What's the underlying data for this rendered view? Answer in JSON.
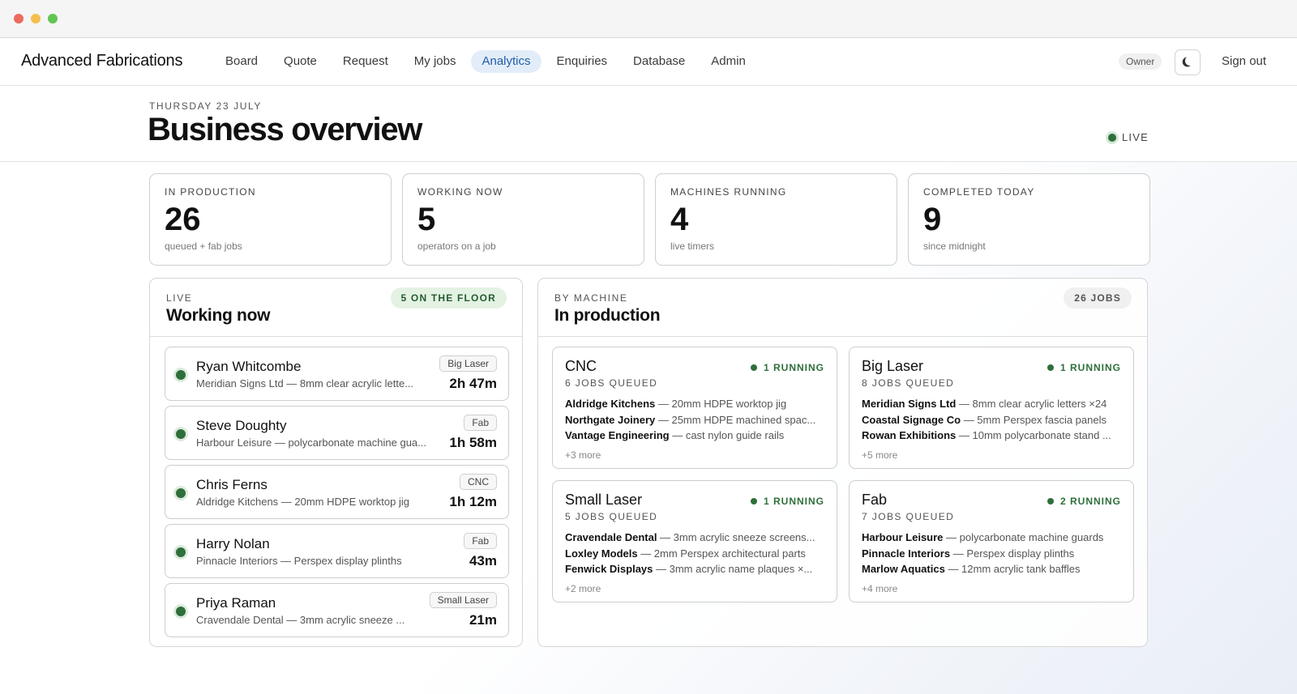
{
  "app": {
    "brand": "Advanced Fabrications",
    "nav": [
      {
        "label": "Board"
      },
      {
        "label": "Quote"
      },
      {
        "label": "Request"
      },
      {
        "label": "My jobs"
      },
      {
        "label": "Analytics",
        "active": true
      },
      {
        "label": "Enquiries"
      },
      {
        "label": "Database"
      },
      {
        "label": "Admin"
      }
    ],
    "role_badge": "Owner",
    "theme_icon": "moon-icon",
    "signout_label": "Sign out"
  },
  "header": {
    "date": "THURSDAY 23 JULY",
    "title": "Business overview",
    "live_label": "LIVE"
  },
  "stats": [
    {
      "label": "IN PRODUCTION",
      "value": "26",
      "sub": "queued + fab jobs"
    },
    {
      "label": "WORKING NOW",
      "value": "5",
      "sub": "operators on a job"
    },
    {
      "label": "MACHINES RUNNING",
      "value": "4",
      "sub": "live timers"
    },
    {
      "label": "COMPLETED TODAY",
      "value": "9",
      "sub": "since midnight"
    }
  ],
  "working": {
    "kicker": "LIVE",
    "title": "Working now",
    "pill": "5 ON THE FLOOR",
    "workers": [
      {
        "name": "Ryan Whitcombe",
        "job": "Meridian Signs Ltd — 8mm clear acrylic lette...",
        "tag": "Big Laser",
        "time": "2h 47m"
      },
      {
        "name": "Steve Doughty",
        "job": "Harbour Leisure — polycarbonate machine gua...",
        "tag": "Fab",
        "time": "1h 58m"
      },
      {
        "name": "Chris Ferns",
        "job": "Aldridge Kitchens — 20mm HDPE worktop jig",
        "tag": "CNC",
        "time": "1h 12m"
      },
      {
        "name": "Harry Nolan",
        "job": "Pinnacle Interiors — Perspex display plinths",
        "tag": "Fab",
        "time": "43m"
      },
      {
        "name": "Priya Raman",
        "job": "Cravendale Dental — 3mm acrylic sneeze ...",
        "tag": "Small Laser",
        "time": "21m"
      }
    ]
  },
  "production": {
    "kicker": "BY MACHINE",
    "title": "In production",
    "pill": "26 JOBS",
    "machines": [
      {
        "name": "CNC",
        "queued": "6 JOBS QUEUED",
        "running": "1 RUNNING",
        "jobs": [
          {
            "client": "Aldridge Kitchens",
            "desc": " — 20mm HDPE worktop jig"
          },
          {
            "client": "Northgate Joinery",
            "desc": " — 25mm HDPE machined spac..."
          },
          {
            "client": "Vantage Engineering",
            "desc": " — cast nylon guide rails"
          }
        ],
        "more": "+3 more"
      },
      {
        "name": "Big Laser",
        "queued": "8 JOBS QUEUED",
        "running": "1 RUNNING",
        "jobs": [
          {
            "client": "Meridian Signs Ltd",
            "desc": " — 8mm clear acrylic letters ×24"
          },
          {
            "client": "Coastal Signage Co",
            "desc": " — 5mm Perspex fascia panels"
          },
          {
            "client": "Rowan Exhibitions",
            "desc": " — 10mm polycarbonate stand ..."
          }
        ],
        "more": "+5 more"
      },
      {
        "name": "Small Laser",
        "queued": "5 JOBS QUEUED",
        "running": "1 RUNNING",
        "jobs": [
          {
            "client": "Cravendale Dental",
            "desc": " — 3mm acrylic sneeze screens..."
          },
          {
            "client": "Loxley Models",
            "desc": " — 2mm Perspex architectural parts"
          },
          {
            "client": "Fenwick Displays",
            "desc": " — 3mm acrylic name plaques ×..."
          }
        ],
        "more": "+2 more"
      },
      {
        "name": "Fab",
        "queued": "7 JOBS QUEUED",
        "running": "2 RUNNING",
        "jobs": [
          {
            "client": "Harbour Leisure",
            "desc": " — polycarbonate machine guards"
          },
          {
            "client": "Pinnacle Interiors",
            "desc": " — Perspex display plinths"
          },
          {
            "client": "Marlow Aquatics",
            "desc": " — 12mm acrylic tank baffles"
          }
        ],
        "more": "+4 more"
      }
    ]
  }
}
